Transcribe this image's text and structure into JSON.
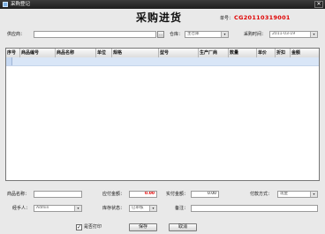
{
  "window": {
    "title": "采购登记",
    "close_glyph": "✕"
  },
  "header": {
    "heading": "采购进货",
    "bill_no_label": "单号：",
    "bill_no": "CG20110319001"
  },
  "top_fields": {
    "supplier_label": "供应商：",
    "supplier_value": "",
    "supplier_button": "...",
    "warehouse_label": "仓库：",
    "warehouse_value": "主仓库",
    "date_label": "采购时间：",
    "date_value": "2011-03-19"
  },
  "grid": {
    "columns": [
      "序号",
      "商品编号",
      "商品名称",
      "单位",
      "规格",
      "型号",
      "生产厂商",
      "数量",
      "单价",
      "折扣",
      "金额"
    ]
  },
  "bottom": {
    "product_name_label": "商品名称：",
    "product_name_value": "",
    "payable_label": "应付金额：",
    "payable_value": "0.00",
    "paid_label": "实付金额：",
    "paid_value": "0.00",
    "pay_method_label": "付款方式：",
    "pay_method_value": "现金",
    "handler_label": "经手人：",
    "handler_value": "Admin",
    "inventory_status_label": "库存状态：",
    "inventory_status_value": "已审核",
    "remark_label": "备注：",
    "remark_value": ""
  },
  "footer": {
    "print_checkbox_label": "是否打印",
    "print_checked": "✓",
    "save_button": "保存",
    "cancel_button": "取消"
  },
  "colors": {
    "title_bg": "#1e1e1e",
    "bill_no": "#e00000",
    "selected_row": "#d9e6f7"
  }
}
